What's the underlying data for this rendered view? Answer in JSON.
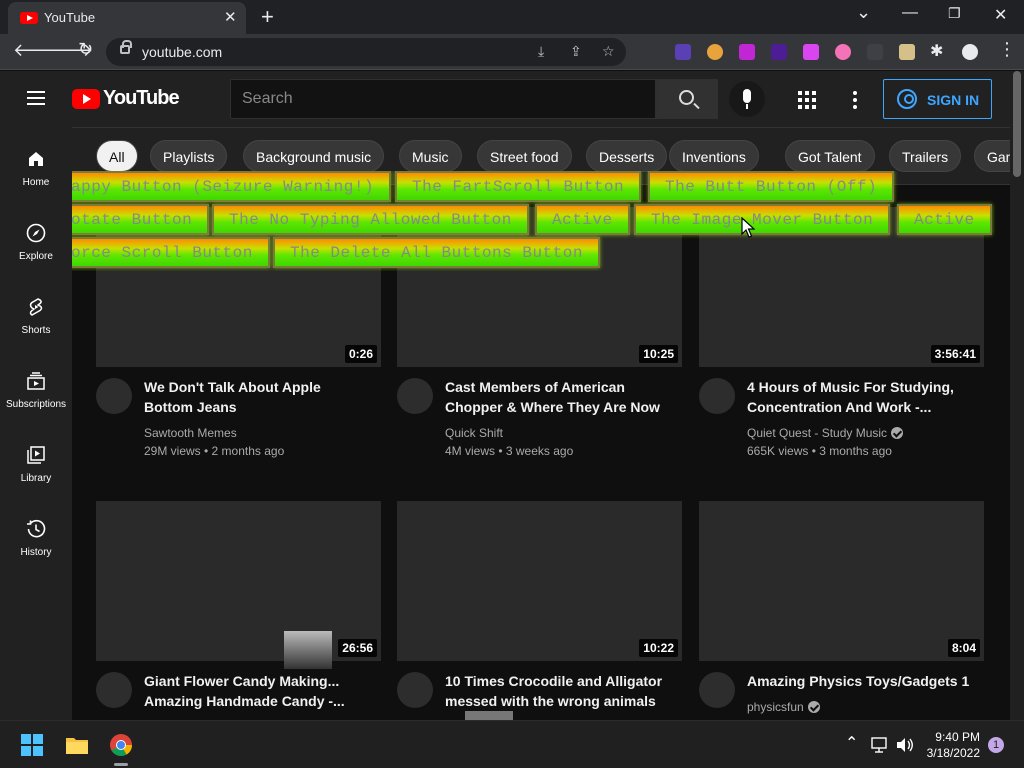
{
  "browser": {
    "tab_title": "YouTube",
    "tab_close": "✕",
    "new_tab": "+",
    "url": "youtube.com",
    "window_minimize": "—",
    "window_restore": "❐",
    "window_close": "✕",
    "dropdown": "⌄"
  },
  "header": {
    "logo_text": "YouTube",
    "search_placeholder": "Search",
    "sign_in_label": "SIGN IN"
  },
  "guide": {
    "items": [
      {
        "label": "Home",
        "icon": "home-icon"
      },
      {
        "label": "Explore",
        "icon": "compass-icon"
      },
      {
        "label": "Shorts",
        "icon": "shorts-icon"
      },
      {
        "label": "Subscriptions",
        "icon": "subscriptions-icon"
      },
      {
        "label": "Library",
        "icon": "library-icon"
      },
      {
        "label": "History",
        "icon": "history-icon"
      }
    ]
  },
  "chips": [
    "All",
    "Playlists",
    "Background music",
    "Music",
    "Street food",
    "Desserts",
    "Inventions",
    "Got Talent",
    "Trailers",
    "Gam"
  ],
  "overlay_buttons": {
    "row1": [
      "appy Button (Seizure Warning!)",
      "The FartScroll Button",
      "The Butt Button (Off)"
    ],
    "row2": [
      "otate Button",
      "The No Typing Allowed Button",
      "Active",
      "The Image Mover Button",
      "Active"
    ],
    "row3": [
      "orce Scroll Button",
      "The Delete All Buttons Button"
    ]
  },
  "videos": [
    {
      "duration": "0:26",
      "title_line1": "We Don't Talk About Apple",
      "title_line2": "Bottom Jeans",
      "channel": "Sawtooth Memes",
      "meta": "29M views • 2 months ago",
      "verified": false
    },
    {
      "duration": "10:25",
      "title_line1": "Cast Members of American",
      "title_line2": "Chopper & Where They Are Now",
      "channel": "Quick Shift",
      "meta": "4M views • 3 weeks ago",
      "verified": false
    },
    {
      "duration": "3:56:41",
      "title_line1": "4 Hours of Music For Studying,",
      "title_line2": "Concentration And Work -...",
      "channel": "Quiet Quest - Study Music",
      "meta": "665K views • 3 months ago",
      "verified": true
    },
    {
      "duration": "26:56",
      "title_line1": "Giant Flower Candy Making...",
      "title_line2": "Amazing Handmade Candy -...",
      "channel": "",
      "meta": "",
      "verified": false
    },
    {
      "duration": "10:22",
      "title_line1": "10 Times Crocodile and Alligator",
      "title_line2": "messed with the wrong animals",
      "channel": "",
      "meta": "",
      "verified": false
    },
    {
      "duration": "8:04",
      "title_line1": "Amazing Physics Toys/Gadgets 1",
      "title_line2": "",
      "channel": "physicsfun",
      "meta": "",
      "verified": true
    }
  ],
  "taskbar": {
    "time": "9:40 PM",
    "date": "3/18/2022",
    "notification_count": "1"
  }
}
